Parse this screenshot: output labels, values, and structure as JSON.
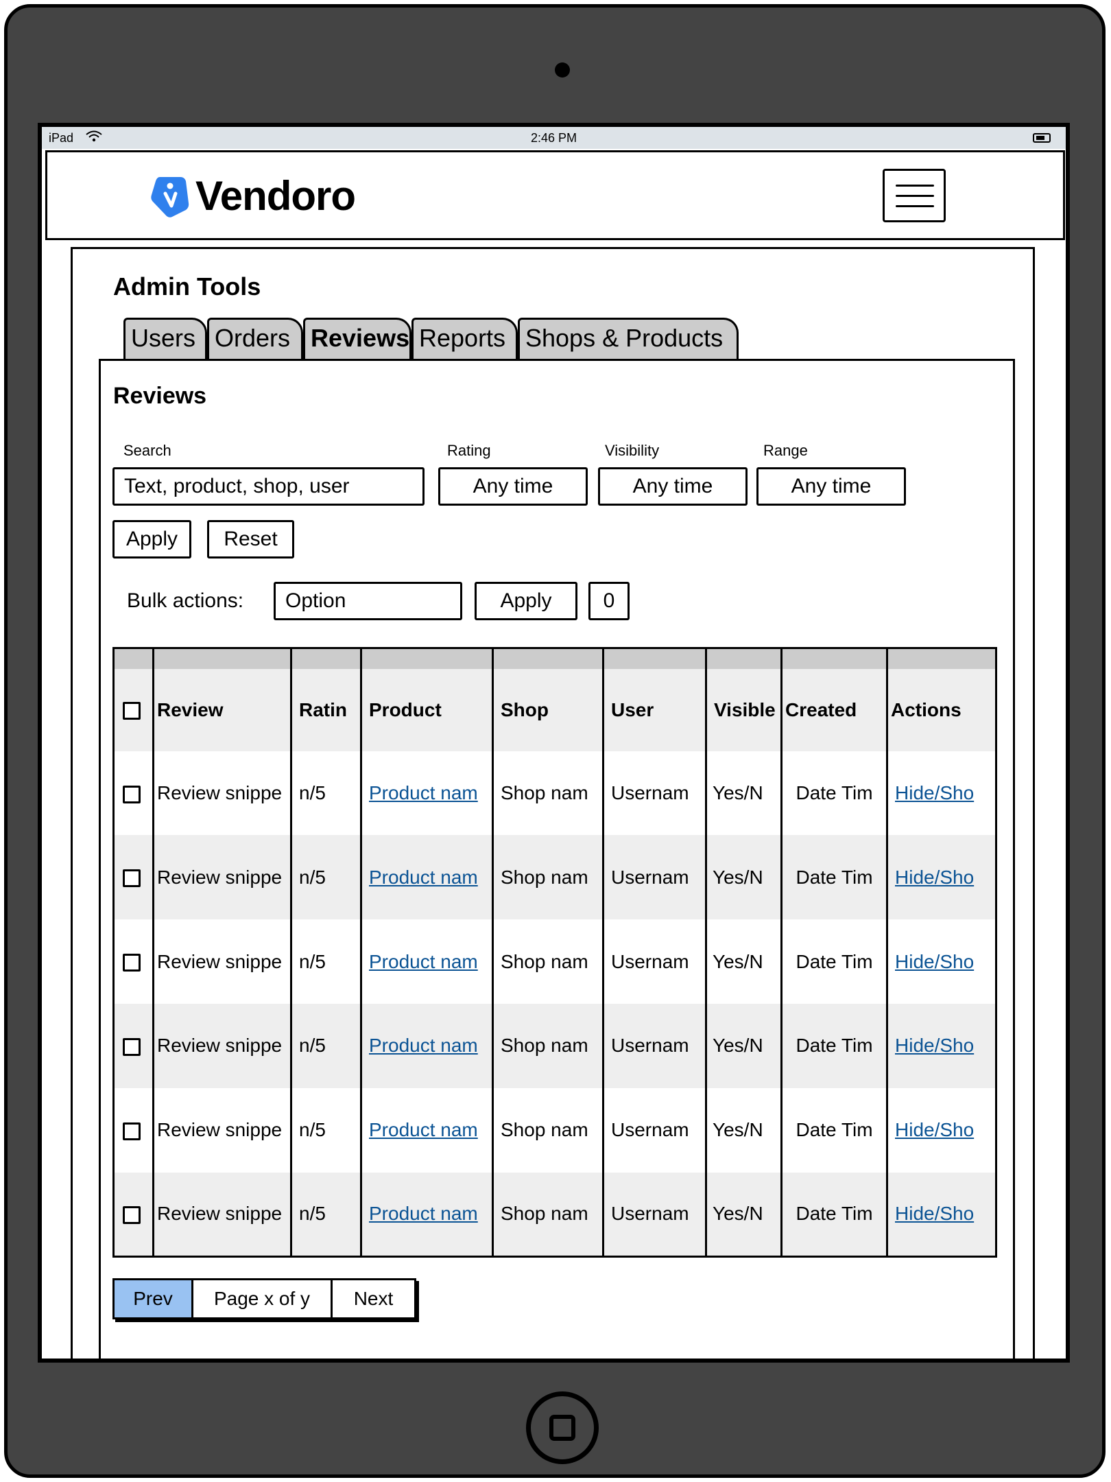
{
  "status_bar": {
    "carrier": "iPad",
    "time": "2:46 PM"
  },
  "header": {
    "brand": "Vendoro",
    "brand_color": "#2f80ed"
  },
  "admin": {
    "title": "Admin Tools",
    "tabs": [
      {
        "label": "Users"
      },
      {
        "label": "Orders"
      },
      {
        "label": "Reviews",
        "active": true
      },
      {
        "label": "Reports"
      },
      {
        "label": "Shops & Products"
      }
    ]
  },
  "reviews": {
    "title": "Reviews",
    "filters": {
      "search_label": "Search",
      "search_value": "Text, product, shop, user",
      "rating_label": "Rating",
      "rating_value": "Any time",
      "visibility_label": "Visibility",
      "visibility_value": "Any time",
      "range_label": "Range",
      "range_value": "Any time",
      "apply_label": "Apply",
      "reset_label": "Reset"
    },
    "bulk": {
      "label": "Bulk actions:",
      "option": "Option",
      "apply_label": "Apply",
      "count": "0"
    },
    "table": {
      "headers": [
        "Review",
        "Ratin",
        "Product",
        "Shop",
        "User",
        "Visible",
        "Created",
        "Actions"
      ],
      "rows": [
        [
          "Review snippe",
          "n/5",
          "Product nam",
          "Shop nam",
          "Usernam",
          "Yes/N",
          "Date Tim",
          "Hide/Sho"
        ],
        [
          "Review snippe",
          "n/5",
          "Product nam",
          "Shop nam",
          "Usernam",
          "Yes/N",
          "Date Tim",
          "Hide/Sho"
        ],
        [
          "Review snippe",
          "n/5",
          "Product nam",
          "Shop nam",
          "Usernam",
          "Yes/N",
          "Date Tim",
          "Hide/Sho"
        ],
        [
          "Review snippe",
          "n/5",
          "Product nam",
          "Shop nam",
          "Usernam",
          "Yes/N",
          "Date Tim",
          "Hide/Sho"
        ],
        [
          "Review snippe",
          "n/5",
          "Product nam",
          "Shop nam",
          "Usernam",
          "Yes/N",
          "Date Tim",
          "Hide/Sho"
        ],
        [
          "Review snippe",
          "n/5",
          "Product nam",
          "Shop nam",
          "Usernam",
          "Yes/N",
          "Date Tim",
          "Hide/Sho"
        ]
      ]
    },
    "pager": {
      "prev": "Prev",
      "page": "Page x of y",
      "next": "Next",
      "active_color": "#99c2f2"
    }
  }
}
